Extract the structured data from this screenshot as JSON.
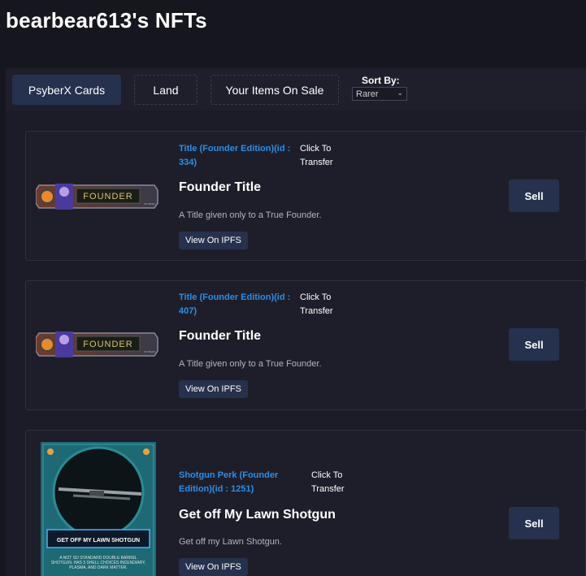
{
  "page": {
    "title": "bearbear613's NFTs"
  },
  "tabs": [
    {
      "label": "PsyberX Cards",
      "active": true
    },
    {
      "label": "Land",
      "active": false
    },
    {
      "label": "Your Items On Sale",
      "active": false
    }
  ],
  "sort": {
    "label": "Sort By:",
    "selected": "Rarer"
  },
  "cards": [
    {
      "item_name": "Title (Founder Edition)(id : 334)",
      "transfer": "Click To Transfer",
      "title": "Founder Title",
      "description": "A Title given only to a True Founder.",
      "ipfs_label": "View On IPFS",
      "sell_label": "Sell",
      "badge_text": "FOUNDER",
      "badge_small": "PSYBERX"
    },
    {
      "item_name": "Title (Founder Edition)(id : 407)",
      "transfer": "Click To Transfer",
      "title": "Founder Title",
      "description": "A Title given only to a True Founder.",
      "ipfs_label": "View On IPFS",
      "sell_label": "Sell",
      "badge_text": "FOUNDER",
      "badge_small": "PSYBERX"
    },
    {
      "item_name": "Shotgun Perk (Founder Edition)(id : 1251)",
      "transfer": "Click To Transfer",
      "title": "Get off My Lawn Shotgun",
      "description": "Get off my Lawn Shotgun.",
      "ipfs_label": "View On IPFS",
      "sell_label": "Sell",
      "card_banner": "GET OFF MY LAWN SHOTGUN",
      "card_flavor": "A NOT SO STANDARD DOUBLE BARREL SHOTGUN. HAS 3 SHELL CHOICES INCENDIARY, PLASMA, AND DARK MATTER."
    }
  ],
  "colors": {
    "background": "#16161f",
    "panel": "#1c1c28",
    "card": "#1e1e2a",
    "accent_blue": "#2a8fe8",
    "button": "#26314d"
  }
}
